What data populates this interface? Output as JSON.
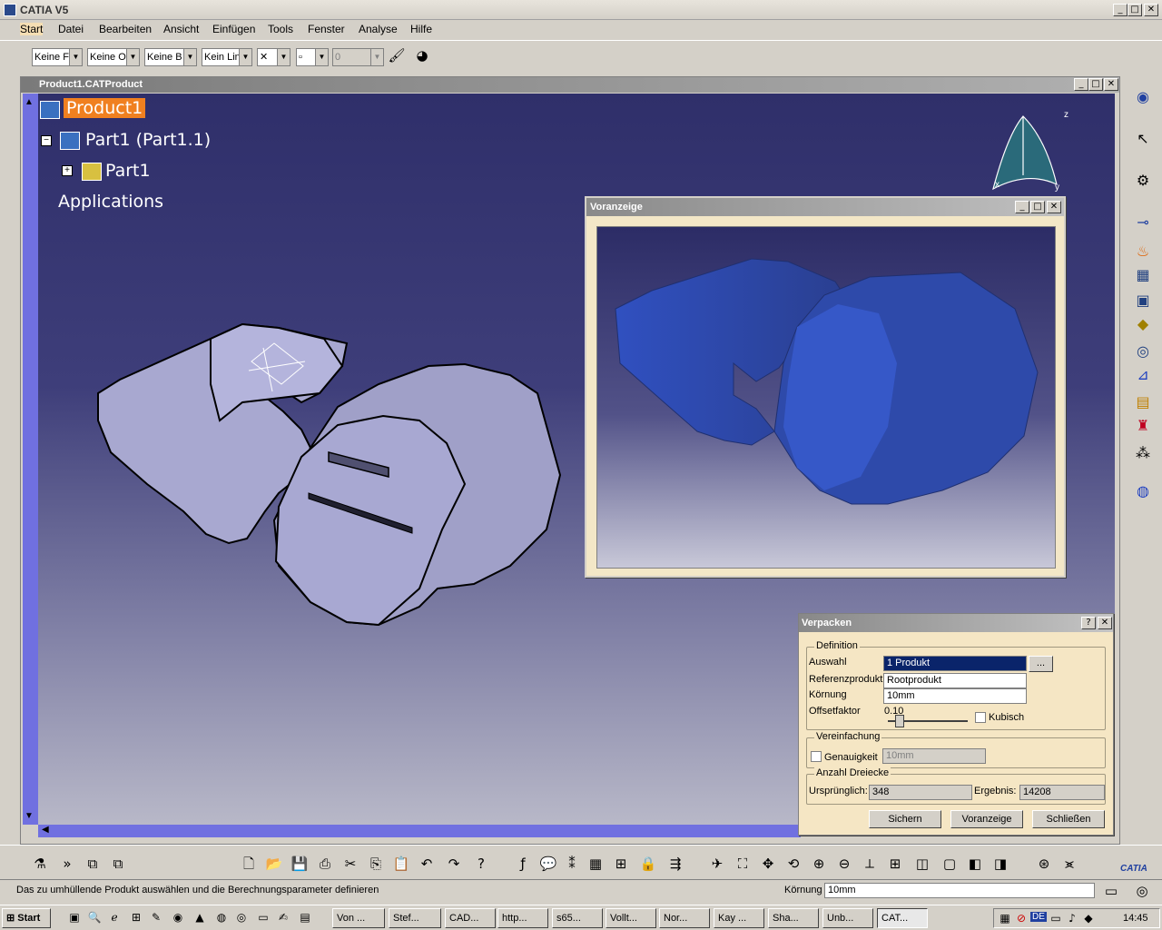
{
  "app": {
    "title": "CATIA V5",
    "accent": "#0a246a"
  },
  "menu": [
    "Start",
    "Datei",
    "Bearbeiten",
    "Ansicht",
    "Einfügen",
    "Tools",
    "Fenster",
    "Analyse",
    "Hilfe"
  ],
  "toolbar": {
    "combo1": "Keine F",
    "combo2": "Keine O",
    "combo3": "Keine B",
    "combo4": "Kein Lin",
    "combo6": "0"
  },
  "document": {
    "title": "Product1.CATProduct"
  },
  "tree": {
    "root": "Product1",
    "child": "Part1 (Part1.1)",
    "grandchild": "Part1",
    "applications": "Applications"
  },
  "compass": {
    "x": "x",
    "y": "y",
    "z": "z"
  },
  "preview": {
    "title": "Voranzeige"
  },
  "dialog": {
    "title": "Verpacken",
    "help": "?",
    "definition": {
      "group": "Definition",
      "auswahl_label": "Auswahl",
      "auswahl_value": "1  Produkt",
      "browse": "...",
      "ref_label": "Referenzprodukt",
      "ref_value": "Rootprodukt",
      "koernung_label": "Körnung",
      "koernung_value": "10mm",
      "offset_label": "Offsetfaktor",
      "offset_value": "0.10",
      "offset_level": 0.1,
      "kubisch_label": "Kubisch"
    },
    "vereinfachung": {
      "group": "Vereinfachung",
      "genauigkeit_label": "Genauigkeit",
      "genauigkeit_value": "10mm"
    },
    "dreiecke": {
      "group": "Anzahl Dreiecke",
      "orig_label": "Ursprünglich:",
      "orig_value": "348",
      "erg_label": "Ergebnis:",
      "erg_value": "14208"
    },
    "buttons": {
      "save": "Sichern",
      "preview": "Voranzeige",
      "close": "Schließen"
    }
  },
  "status": {
    "message": "Das zu umhüllende Produkt auswählen und die Berechnungsparameter definieren",
    "koernung_label": "Körnung",
    "koernung_value": "10mm"
  },
  "catia_logo": "CATIA",
  "taskbar": {
    "start": "Start",
    "tasks": [
      "Von ...",
      "Stef...",
      "CAD...",
      "http...",
      "s65...",
      "Vollt...",
      "Nor...",
      "Kay ...",
      "Sha...",
      "Unb...",
      "CAT..."
    ],
    "tray_lang": "DE",
    "clock": "14:45"
  }
}
